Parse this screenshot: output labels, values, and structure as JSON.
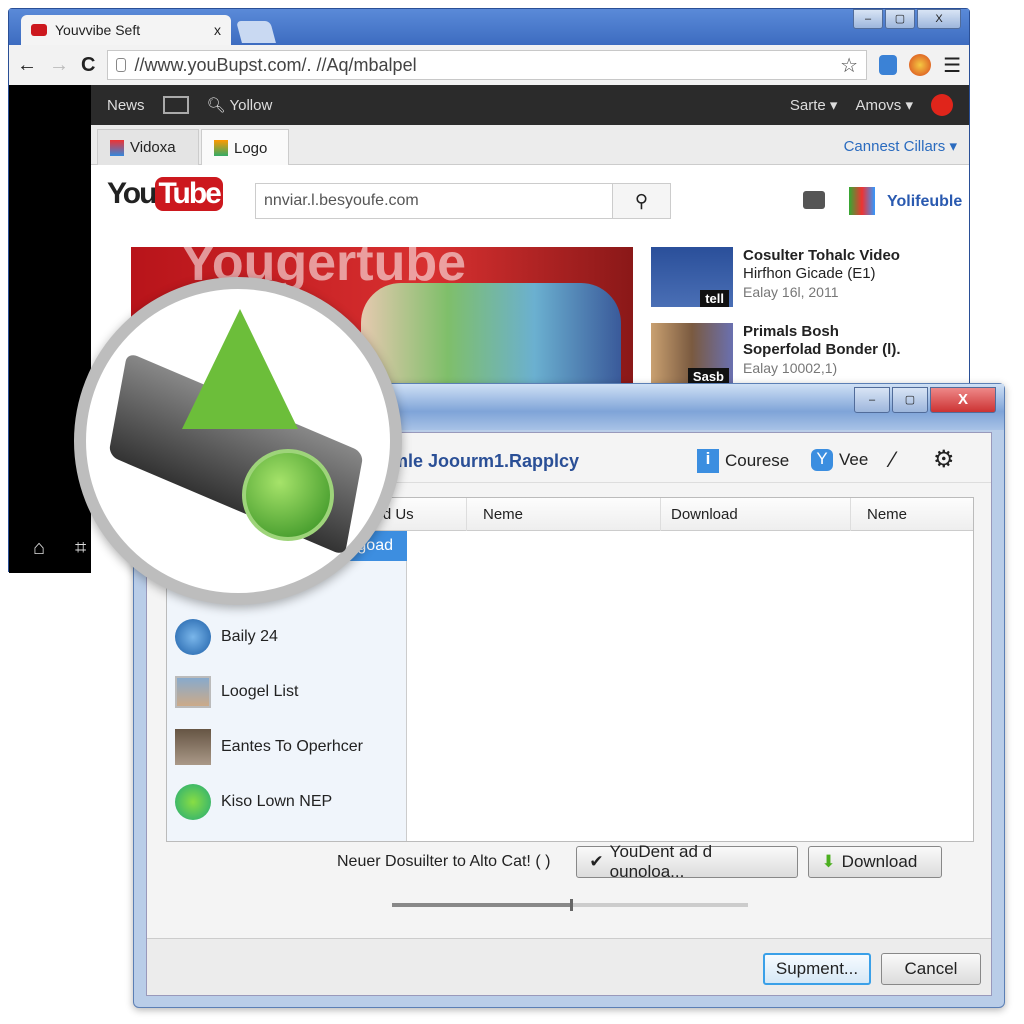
{
  "browser": {
    "tab_title": "Youvvibe Seft",
    "tab_close": "x",
    "url": "//www.youBupst.com/. //Aq/mbalpel",
    "win_controls": [
      "–",
      "▢",
      "X"
    ]
  },
  "nav": {
    "news": "News",
    "search_label": "Yollow",
    "sarte": "Sarte",
    "amovs": "Amovs"
  },
  "page_tabs": [
    {
      "label": "Vidoxa"
    },
    {
      "label": "Logo"
    }
  ],
  "page_tabs_right": "Cannest Cillars",
  "youtube": {
    "logo_you": "You",
    "logo_tube": "Tube",
    "search_value": "nnviar.l.besyoufe.com",
    "brand_label": "Yolifeuble",
    "banner_text": "Yougertube"
  },
  "videos": [
    {
      "thumb_label": "tell",
      "title": "Cosulter Tohalc Video",
      "subtitle": "Hirfhon Gicade (E1)",
      "date": "Ealay 16l, 2011"
    },
    {
      "thumb_label": "Sasb",
      "title": "Primals Bosh",
      "subtitle": "Soperfolad Bonder (l).",
      "date": "Ealay 10002,1)"
    }
  ],
  "dialog": {
    "win_controls": [
      "–",
      "▢",
      "X"
    ],
    "title": "imle Joourm1.Rapplcy",
    "toolbar": {
      "course": "Courese",
      "view": "Vee"
    },
    "columns": [
      "ved Us",
      "Neme",
      "Download",
      "Neme"
    ],
    "sidebar": [
      {
        "label": "goad",
        "selected": true
      },
      {
        "label": "Baily 24"
      },
      {
        "label": "Loogel List"
      },
      {
        "label": "Eantes To Operhcer"
      },
      {
        "label": "Kiso Lown NEP"
      }
    ],
    "status_text": "Neuer Dosuilter to Alto Cat! (  )",
    "youdent_button": "YouDent ad d ounoloa...",
    "download_button": "Download",
    "ok_button": "Supment...",
    "cancel_button": "Cancel",
    "progress": 0.5
  },
  "colors": {
    "accent": "#3f6fc4",
    "youtube_red": "#cc181e",
    "selected": "#3d8ee0",
    "green": "#4caf20"
  }
}
